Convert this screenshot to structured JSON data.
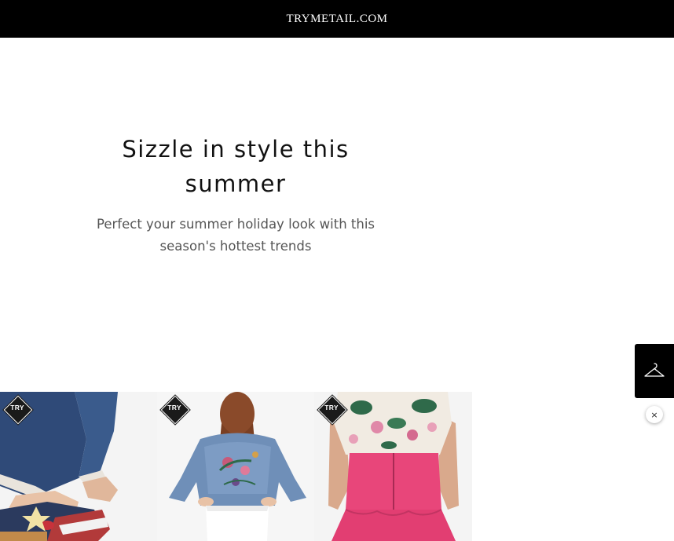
{
  "header": {
    "brand": "TRYMETAIL.COM"
  },
  "hero": {
    "title": "Sizzle in style this summer",
    "subtitle": "Perfect your summer holiday look with this season's hottest trends"
  },
  "products": [
    {
      "badge": "TRY",
      "icon": "shoe-image"
    },
    {
      "badge": "TRY",
      "icon": "denim-jacket-image"
    },
    {
      "badge": "TRY",
      "icon": "floral-top-pink-skirt-image"
    }
  ],
  "widget": {
    "wardrobe_icon": "hanger-icon",
    "close_label": "×"
  },
  "colors": {
    "header_bg": "#000000",
    "badge_bg": "#1a1a1a",
    "skirt_pink": "#e8467a"
  }
}
